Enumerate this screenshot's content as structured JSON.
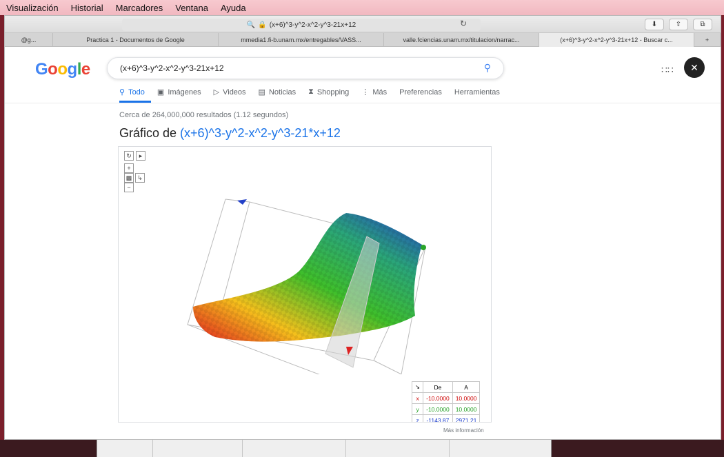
{
  "menubar": {
    "items": [
      "Visualización",
      "Historial",
      "Marcadores",
      "Ventana",
      "Ayuda"
    ]
  },
  "browser": {
    "url": "(x+6)^3-y^2-x^2-y^3-21x+12",
    "tabs": [
      {
        "label": "@g..."
      },
      {
        "label": "Practica 1 - Documentos de Google"
      },
      {
        "label": "mmedia1.fi-b.unam.mx/entregables/VASS..."
      },
      {
        "label": "valle.fciencias.unam.mx/titulacion/narrac..."
      },
      {
        "label": "(x+6)^3-y^2-x^2-y^3-21x+12 - Buscar c..."
      }
    ],
    "new_tab_symbol": "+"
  },
  "google": {
    "logo_letters": [
      "G",
      "o",
      "o",
      "g",
      "l",
      "e"
    ],
    "query": "(x+6)^3-y^2-x^2-y^3-21x+12",
    "nav": [
      {
        "label": "Todo",
        "icon": "search-icon"
      },
      {
        "label": "Imágenes",
        "icon": "image-icon"
      },
      {
        "label": "Videos",
        "icon": "video-icon"
      },
      {
        "label": "Noticias",
        "icon": "news-icon"
      },
      {
        "label": "Shopping",
        "icon": "tag-icon"
      },
      {
        "label": "Más",
        "icon": "more-dots-icon"
      },
      {
        "label": "Preferencias",
        "icon": ""
      },
      {
        "label": "Herramientas",
        "icon": ""
      }
    ],
    "results_count": "Cerca de 264,000,000 resultados (1.12 segundos)",
    "graph_title_prefix": "Gráfico de ",
    "graph_title_function": "(x+6)^3-y^2-x^2-y^3-21*x+12",
    "more_info": "Más información"
  },
  "range_table": {
    "headers": [
      "De",
      "A"
    ],
    "rows": [
      {
        "axis": "x",
        "from": "-10.0000",
        "to": "10.0000"
      },
      {
        "axis": "y",
        "from": "-10.0000",
        "to": "10.0000"
      },
      {
        "axis": "z",
        "from": "-1143.87",
        "to": "2971.21"
      }
    ]
  },
  "colors": {
    "google_blue": "#1a73e8",
    "menubar_pink": "#f4c2c9",
    "axis_x": "#cc0000",
    "axis_y": "#1e9e1e",
    "axis_z": "#1a3ccc"
  }
}
